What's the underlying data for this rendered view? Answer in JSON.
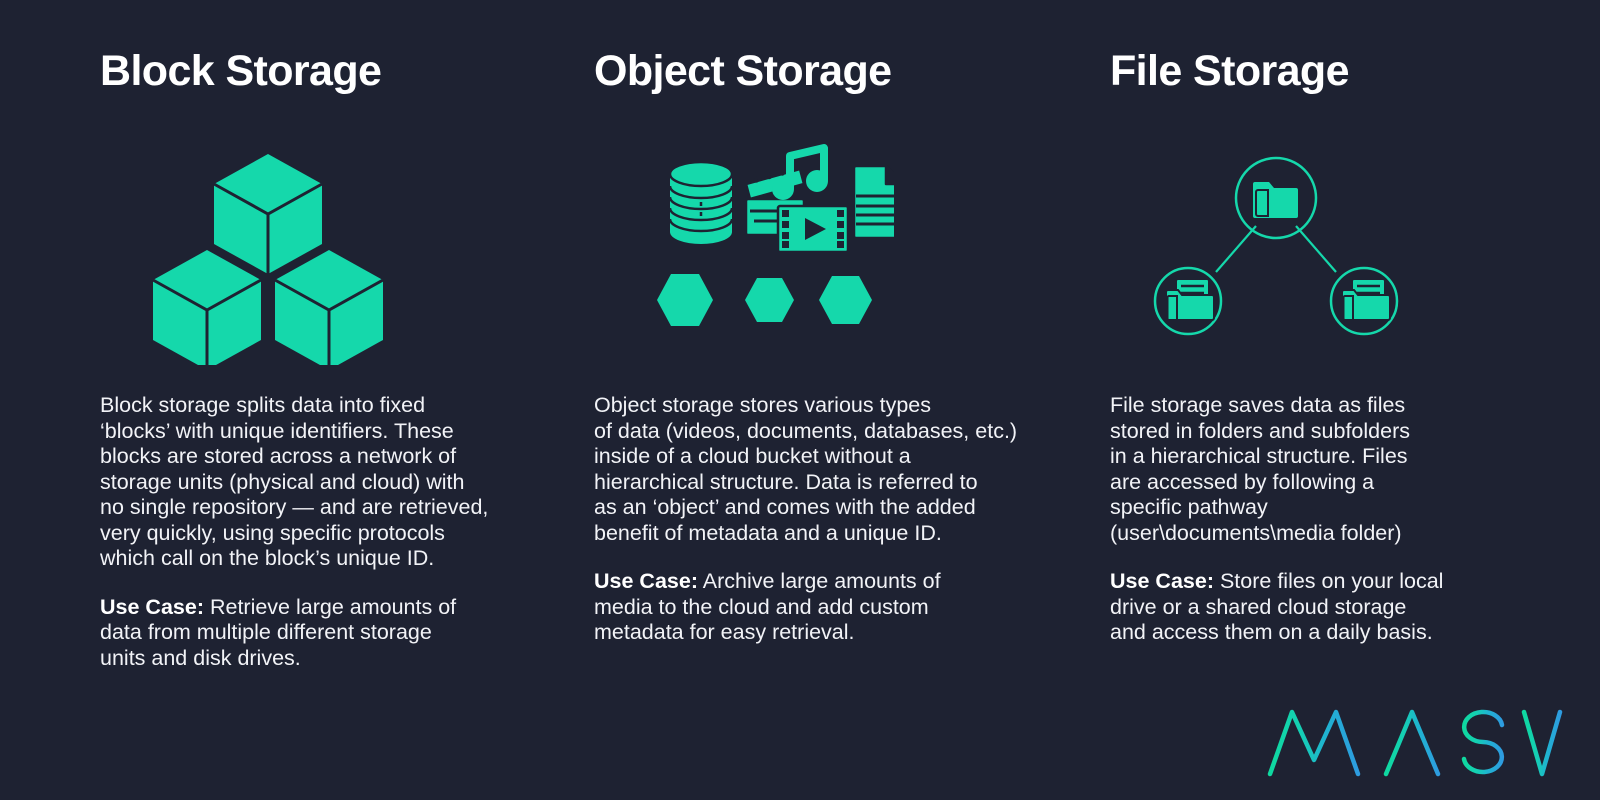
{
  "theme": {
    "background": "#1e2232",
    "accent_teal": "#15d8ab",
    "text_primary": "#f2f3f7",
    "heading": "#ffffff",
    "logo_gradient_start": "#10d9a3",
    "logo_gradient_end": "#2a9fe0"
  },
  "columns": [
    {
      "id": "block",
      "title": "Block Storage",
      "icon_set": "isometric-cubes",
      "body": "Block storage splits data into fixed\n‘blocks’ with unique identifiers. These\nblocks are stored across a network of\nstorage units (physical and cloud) with\nno single repository — and are retrieved,\nvery quickly, using specific protocols\nwhich call on the block’s unique ID.",
      "use_case_label": "Use Case:",
      "use_case_text": " Retrieve large amounts of\ndata from multiple different storage\nunits and disk drives."
    },
    {
      "id": "object",
      "title": "Object Storage",
      "icon_set": "media-objects-and-hexagons",
      "body": "Object storage stores various types\nof data (videos, documents, databases, etc.)\ninside of a cloud bucket without a\nhierarchical structure. Data is referred to\nas an ‘object’ and comes with the added\nbenefit of metadata and a unique ID.",
      "use_case_label": "Use Case:",
      "use_case_text": " Archive large amounts of\nmedia to the cloud and add custom\nmetadata for easy retrieval."
    },
    {
      "id": "file",
      "title": "File Storage",
      "icon_set": "folder-hierarchy-tree",
      "body": "File storage saves data as files\nstored in folders and subfolders\nin a hierarchical structure. Files\nare accessed by following a\nspecific pathway\n(user\\documents\\media folder)",
      "use_case_label": "Use Case:",
      "use_case_text": " Store files on your local\ndrive or a shared cloud storage\nand access them on a daily basis."
    }
  ],
  "logo": {
    "text": "MASV",
    "letters": [
      "M",
      "A",
      "S",
      "V"
    ]
  }
}
